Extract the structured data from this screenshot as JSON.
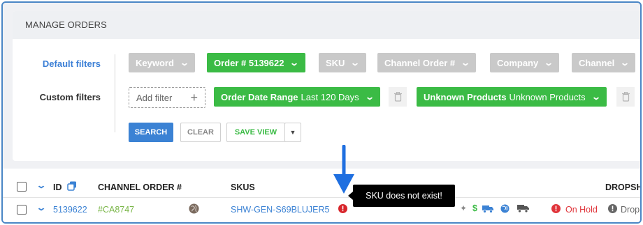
{
  "panel": {
    "title": "MANAGE ORDERS"
  },
  "filters": {
    "default_label": "Default filters",
    "custom_label": "Custom filters",
    "default": [
      {
        "label": "Keyword",
        "active": false
      },
      {
        "label": "Order # 5139622",
        "active": true
      },
      {
        "label": "SKU",
        "active": false
      },
      {
        "label": "Channel Order #",
        "active": false
      },
      {
        "label": "Company",
        "active": false
      },
      {
        "label": "Channel",
        "active": false
      }
    ],
    "add_filter_label": "Add filter",
    "add_filter_plus": "+",
    "custom": [
      {
        "name": "Order Date Range",
        "value": "Last 120 Days"
      },
      {
        "name": "Unknown Products",
        "value": "Unknown Products"
      }
    ]
  },
  "actions": {
    "search": "SEARCH",
    "clear": "CLEAR",
    "save_view": "SAVE VIEW"
  },
  "table": {
    "headers": {
      "id": "ID",
      "channel_order": "CHANNEL ORDER #",
      "skus": "SKUS",
      "dropship": "DROPSH"
    },
    "row": {
      "id": "5139622",
      "channel_order": "#CA8747",
      "sku": "SHW-GEN-S69BLUJER5",
      "status": "On Hold",
      "dropship": "DropS"
    }
  },
  "tooltip": {
    "text": "SKU does not exist!"
  },
  "colors": {
    "accent_blue": "#3b82d4",
    "active_green": "#3bbb45",
    "inactive_gray": "#c9c9c9",
    "error_red": "#e0343a",
    "frame_border": "#4a86c5"
  }
}
